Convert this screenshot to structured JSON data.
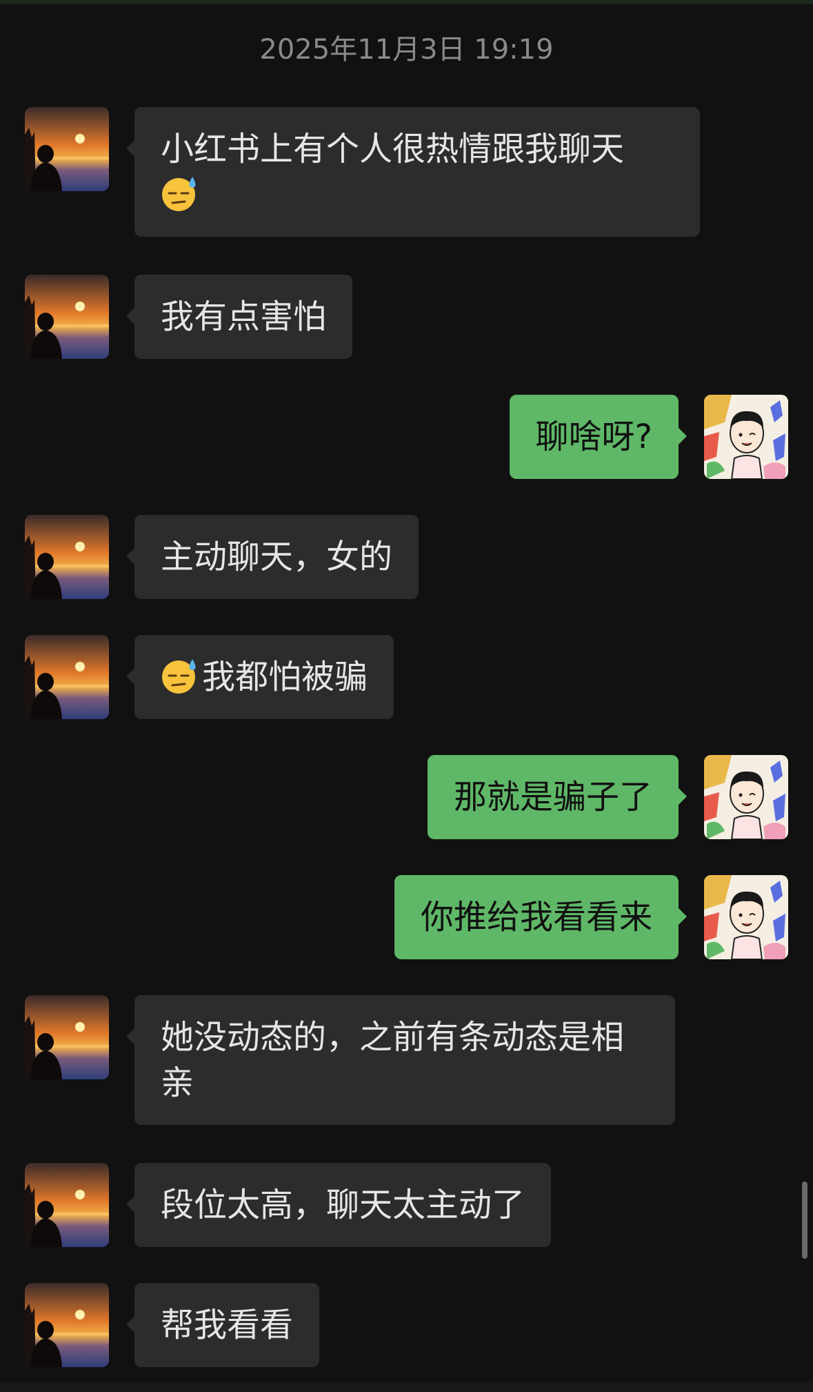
{
  "timestamp": "2025年11月3日 19:19",
  "messages": [
    {
      "side": "left",
      "text": "小红书上有个人很热情跟我聊天",
      "emoji": "sweat-face-emoji",
      "emoji_position": "after"
    },
    {
      "side": "left",
      "text": "我有点害怕"
    },
    {
      "side": "right",
      "text": "聊啥呀?"
    },
    {
      "side": "left",
      "text": "主动聊天，女的"
    },
    {
      "side": "left",
      "text": "我都怕被骗",
      "emoji": "sweat-face-emoji",
      "emoji_position": "before"
    },
    {
      "side": "right",
      "text": "那就是骗子了"
    },
    {
      "side": "right",
      "text": "你推给我看看来"
    },
    {
      "side": "left",
      "text": "她没动态的，之前有条动态是相亲"
    },
    {
      "side": "left",
      "text": "段位太高，聊天太主动了"
    },
    {
      "side": "left",
      "text": "帮我看看"
    }
  ],
  "avatars": {
    "left": "sunset-silhouette-avatar",
    "right": "cartoon-boy-avatar"
  },
  "colors": {
    "background": "#111111",
    "incoming_bubble": "#2c2c2c",
    "outgoing_bubble": "#5fb867",
    "timestamp_text": "#8a8a8a"
  }
}
